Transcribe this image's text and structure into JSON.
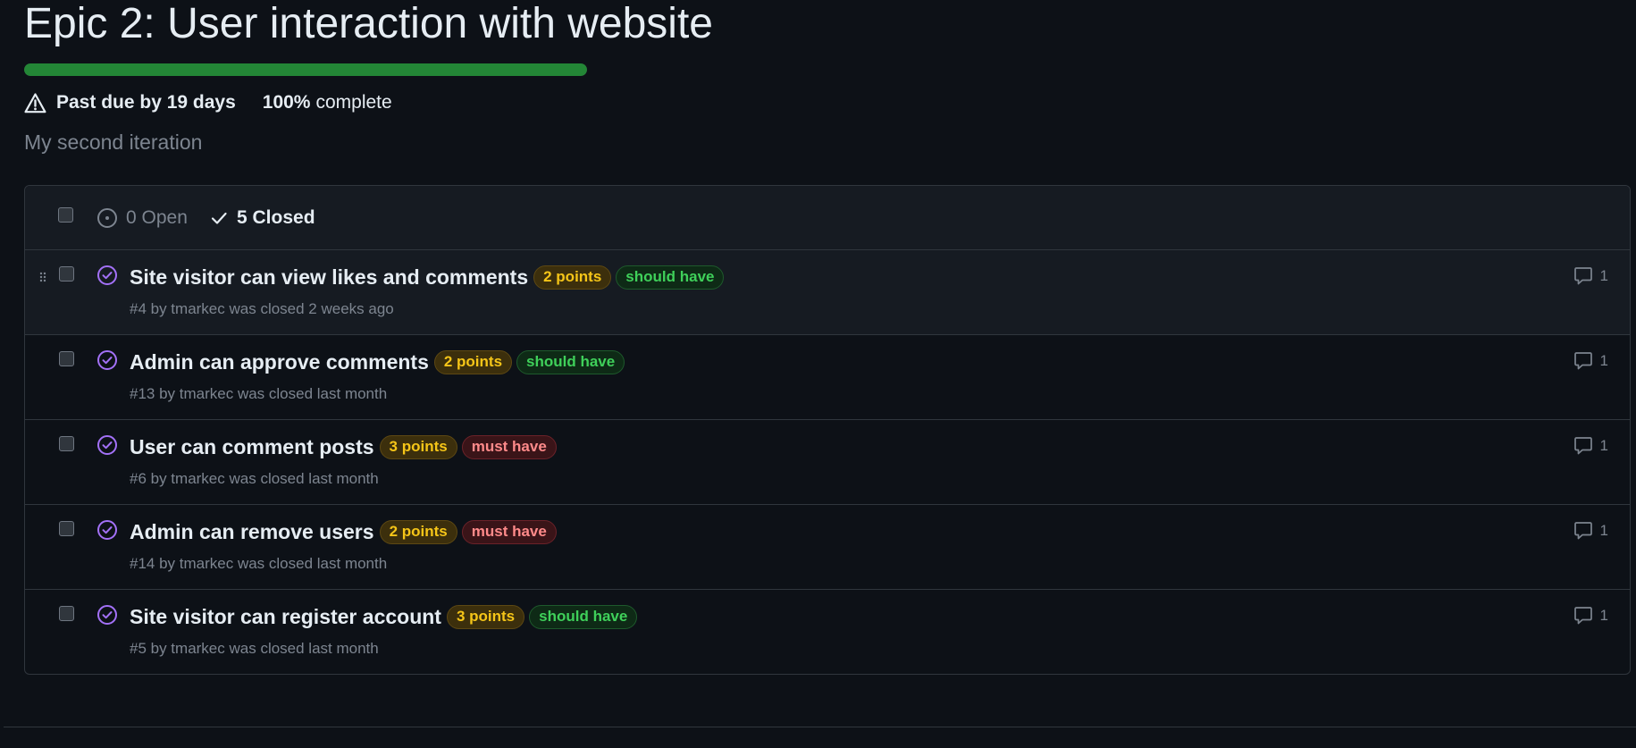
{
  "milestone": {
    "title": "Epic 2: User interaction with website",
    "progress_fraction": 1.0,
    "due_text": "Past due by 19 days",
    "percent_text": "100%",
    "complete_word": "complete",
    "description": "My second iteration"
  },
  "filters": {
    "open_label": "0 Open",
    "closed_label": "5 Closed"
  },
  "colors": {
    "progress": "#238636",
    "closed_issue_icon": "#a371f7",
    "points_label": "#f5c518",
    "should_have_label": "#3fd05a",
    "must_have_label": "#ff8a8a"
  },
  "issues": [
    {
      "title": "Site visitor can view likes and comments",
      "labels": [
        "2 points",
        "should have"
      ],
      "meta": "#4 by tmarkec was closed 2 weeks ago",
      "comments": "1"
    },
    {
      "title": "Admin can approve comments",
      "labels": [
        "2 points",
        "should have"
      ],
      "meta": "#13 by tmarkec was closed last month",
      "comments": "1"
    },
    {
      "title": "User can comment posts",
      "labels": [
        "3 points",
        "must have"
      ],
      "meta": "#6 by tmarkec was closed last month",
      "comments": "1"
    },
    {
      "title": "Admin can remove users",
      "labels": [
        "2 points",
        "must have"
      ],
      "meta": "#14 by tmarkec was closed last month",
      "comments": "1"
    },
    {
      "title": "Site visitor can register account",
      "labels": [
        "3 points",
        "should have"
      ],
      "meta": "#5 by tmarkec was closed last month",
      "comments": "1"
    }
  ]
}
